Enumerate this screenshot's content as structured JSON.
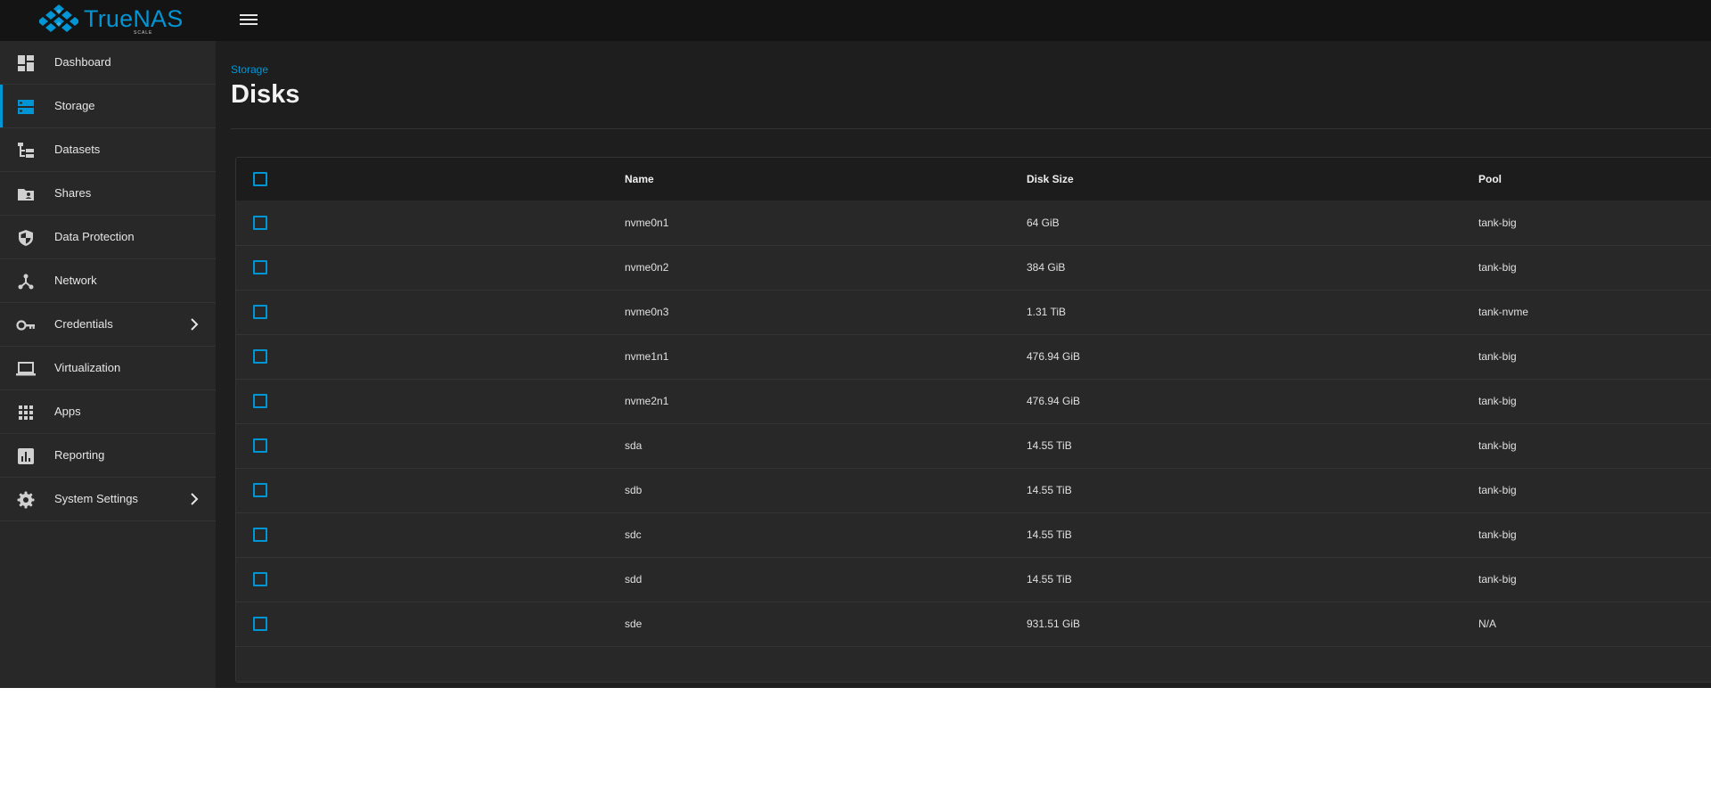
{
  "brand": {
    "name": "TrueNAS",
    "edition": "SCALE"
  },
  "colors": {
    "accent": "#0095d5",
    "topbar": "#141414",
    "sidebar": "#282828",
    "content": "#1e1e1e"
  },
  "sidebar": {
    "items": [
      {
        "label": "Dashboard",
        "icon": "dashboard-icon",
        "active": false,
        "expandable": false
      },
      {
        "label": "Storage",
        "icon": "storage-icon",
        "active": true,
        "expandable": false
      },
      {
        "label": "Datasets",
        "icon": "datasets-icon",
        "active": false,
        "expandable": false
      },
      {
        "label": "Shares",
        "icon": "shares-icon",
        "active": false,
        "expandable": false
      },
      {
        "label": "Data Protection",
        "icon": "shield-icon",
        "active": false,
        "expandable": false
      },
      {
        "label": "Network",
        "icon": "network-icon",
        "active": false,
        "expandable": false
      },
      {
        "label": "Credentials",
        "icon": "key-icon",
        "active": false,
        "expandable": true
      },
      {
        "label": "Virtualization",
        "icon": "laptop-icon",
        "active": false,
        "expandable": false
      },
      {
        "label": "Apps",
        "icon": "apps-grid-icon",
        "active": false,
        "expandable": false
      },
      {
        "label": "Reporting",
        "icon": "reporting-icon",
        "active": false,
        "expandable": false
      },
      {
        "label": "System Settings",
        "icon": "gear-icon",
        "active": false,
        "expandable": true
      }
    ]
  },
  "page": {
    "breadcrumb": "Storage",
    "title": "Disks"
  },
  "table": {
    "columns": [
      "Name",
      "Disk Size",
      "Pool"
    ],
    "rows": [
      {
        "name": "nvme0n1",
        "size": "64 GiB",
        "pool": "tank-big"
      },
      {
        "name": "nvme0n2",
        "size": "384 GiB",
        "pool": "tank-big"
      },
      {
        "name": "nvme0n3",
        "size": "1.31 TiB",
        "pool": "tank-nvme"
      },
      {
        "name": "nvme1n1",
        "size": "476.94 GiB",
        "pool": "tank-big"
      },
      {
        "name": "nvme2n1",
        "size": "476.94 GiB",
        "pool": "tank-big"
      },
      {
        "name": "sda",
        "size": "14.55 TiB",
        "pool": "tank-big"
      },
      {
        "name": "sdb",
        "size": "14.55 TiB",
        "pool": "tank-big"
      },
      {
        "name": "sdc",
        "size": "14.55 TiB",
        "pool": "tank-big"
      },
      {
        "name": "sdd",
        "size": "14.55 TiB",
        "pool": "tank-big"
      },
      {
        "name": "sde",
        "size": "931.51 GiB",
        "pool": "N/A"
      }
    ]
  }
}
